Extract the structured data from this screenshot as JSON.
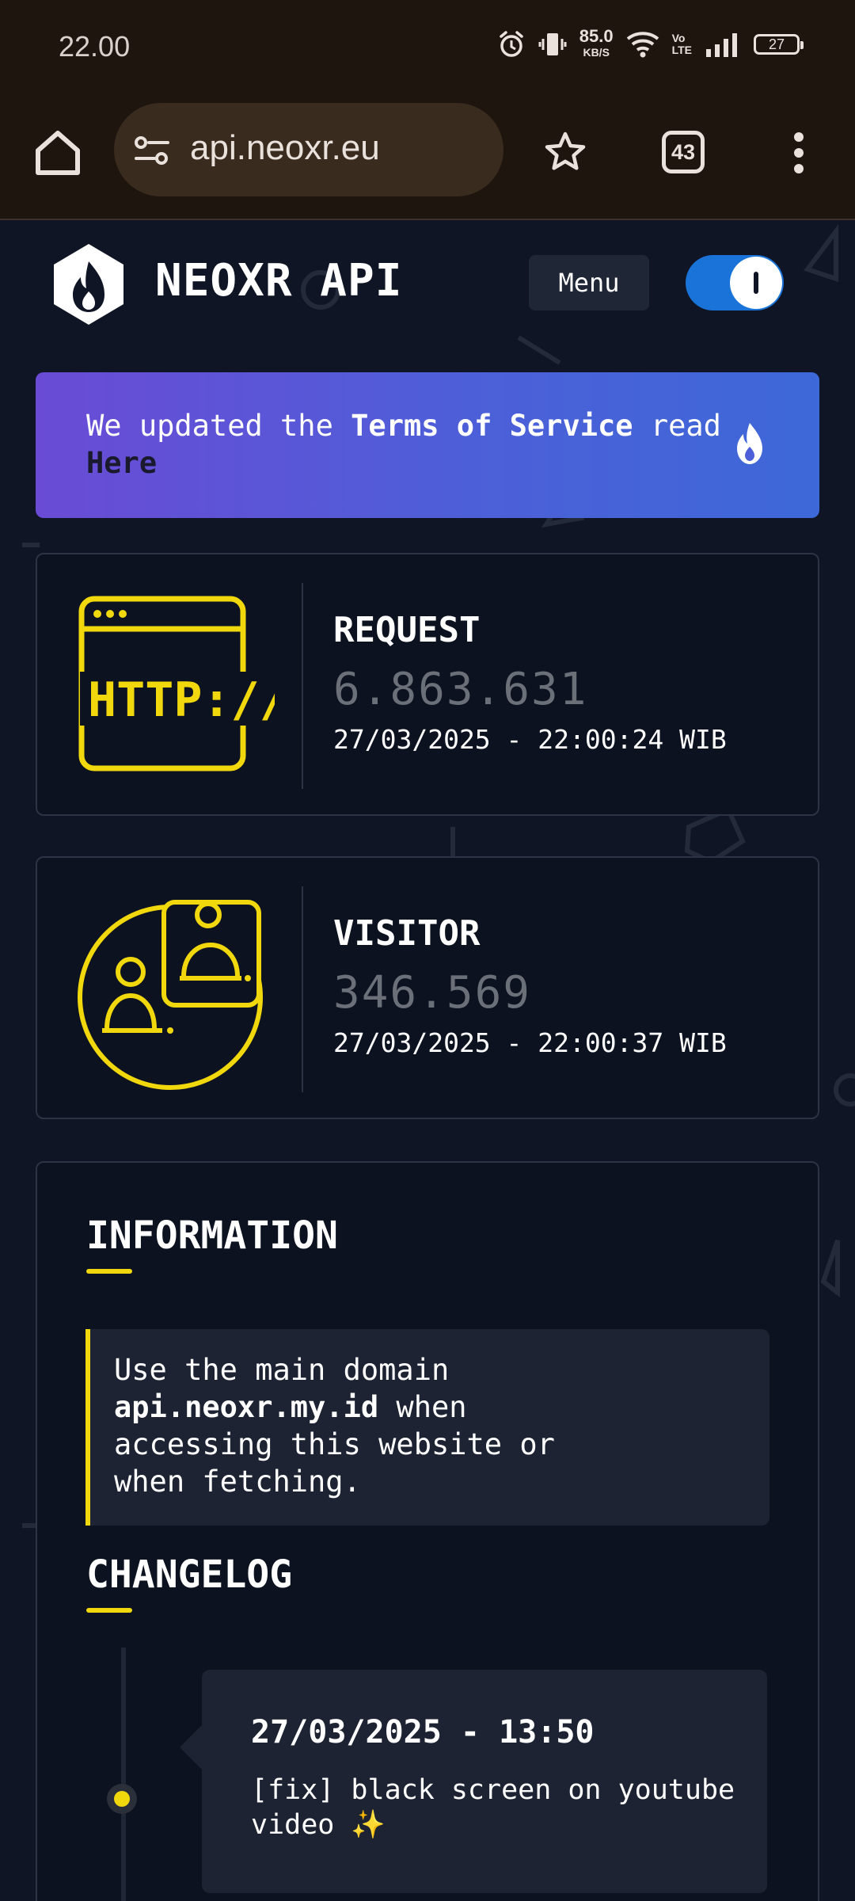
{
  "status_bar": {
    "time": "22.00",
    "net_speed_value": "85.0",
    "net_speed_unit": "KB/S",
    "volte_top": "Vo",
    "volte_bottom": "LTE",
    "battery": "27",
    "icons": [
      "alarm-icon",
      "vibrate-icon",
      "wifi-icon",
      "signal-icon",
      "battery-icon"
    ]
  },
  "browser": {
    "url": "api.neoxr.eu",
    "tab_count": "43",
    "icons": [
      "home-icon",
      "site-settings-icon",
      "bookmark-star-icon",
      "tabs-icon",
      "more-icon"
    ]
  },
  "header": {
    "brand": "NEOXR API",
    "menu_label": "Menu",
    "theme_toggle_on": true,
    "logo_icon": "flame-logo-icon"
  },
  "banner": {
    "text_before": "We updated the ",
    "text_bold": "Terms of Service",
    "text_after": " read ",
    "link": "Here",
    "icon": "flame-icon"
  },
  "stats": [
    {
      "title": "REQUEST",
      "value": "6.863.631",
      "time": "27/03/2025 - 22:00:24 WIB",
      "icon": "http-icon"
    },
    {
      "title": "VISITOR",
      "value": "346.569",
      "time": "27/03/2025 - 22:00:37 WIB",
      "icon": "visitors-icon"
    }
  ],
  "information": {
    "title": "INFORMATION",
    "notice_before": "Use the main domain ",
    "notice_domain": "api.neoxr.my.id",
    "notice_after": " when accessing this website or when fetching."
  },
  "changelog": {
    "title": "CHANGELOG",
    "entries": [
      {
        "date": "27/03/2025 - 13:50",
        "text": "[fix] black screen on youtube video ✨"
      }
    ]
  },
  "colors": {
    "page_bg": "#0f1524",
    "accent_yellow": "#f1d80c",
    "banner_start": "#6a4bd6",
    "banner_end": "#3d68d8",
    "toggle_blue": "#1a73d9",
    "browser_bar": "#1e150f"
  }
}
